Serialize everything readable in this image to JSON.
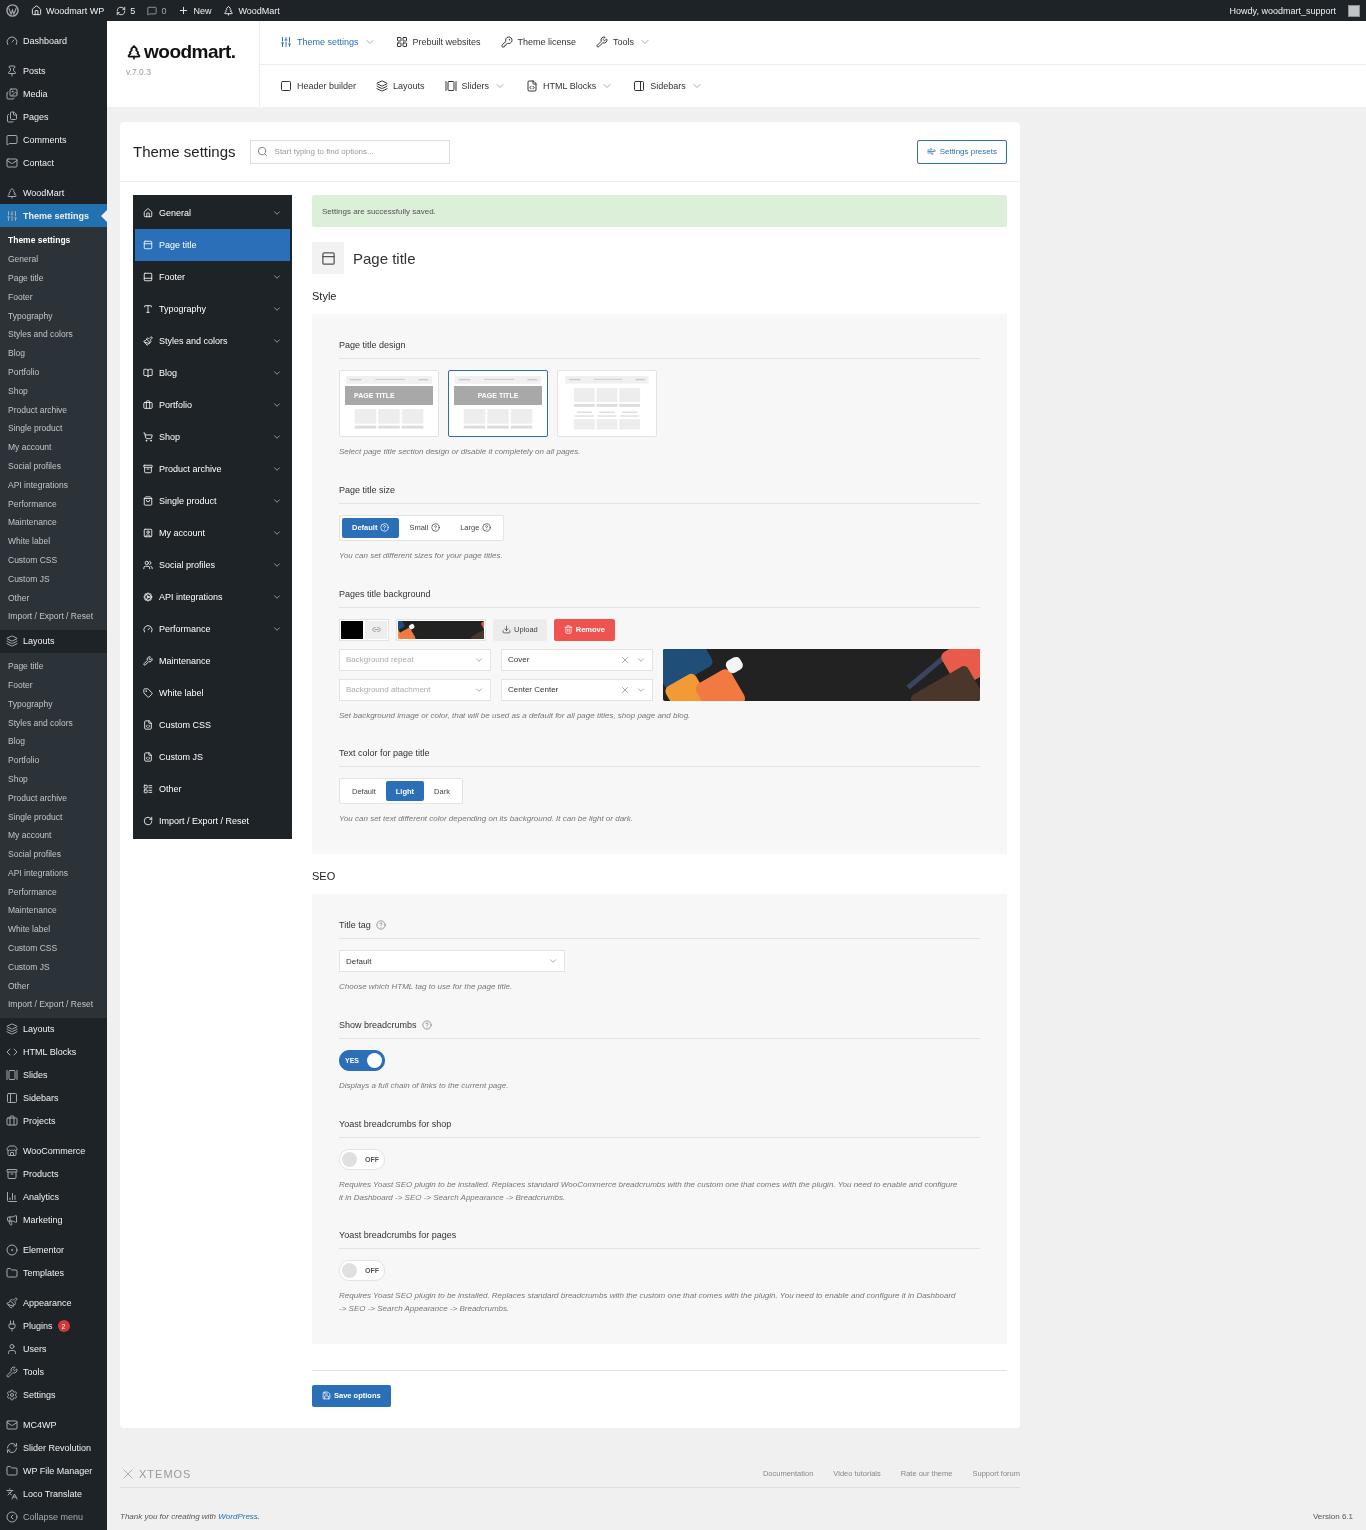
{
  "top_bar": {
    "site": "Woodmart WP",
    "updates": "5",
    "comments": "0",
    "new": "New",
    "brand": "WoodMart",
    "greeting": "Howdy, woodmart_support"
  },
  "admin_menu": [
    {
      "items": [
        {
          "label": "Dashboard",
          "selected": false
        }
      ]
    },
    {
      "items": [
        {
          "label": "Posts",
          "selected": false
        },
        {
          "label": "Media",
          "selected": false
        },
        {
          "label": "Pages",
          "selected": false
        },
        {
          "label": "Comments",
          "selected": false
        },
        {
          "label": "Contact",
          "selected": false
        }
      ]
    },
    {
      "items": [
        {
          "label": "WoodMart",
          "selected": false
        },
        {
          "label": "Theme settings",
          "selected": true,
          "submenu": [
            {
              "label": "Theme settings",
              "selected": true
            },
            {
              "label": "General",
              "selected": false
            },
            {
              "label": "Page title",
              "selected": false
            },
            {
              "label": "Footer",
              "selected": false
            },
            {
              "label": "Typography",
              "selected": false
            },
            {
              "label": "Styles and colors",
              "selected": false
            },
            {
              "label": "Blog",
              "selected": false
            },
            {
              "label": "Portfolio",
              "selected": false
            },
            {
              "label": "Shop",
              "selected": false
            },
            {
              "label": "Product archive",
              "selected": false
            },
            {
              "label": "Single product",
              "selected": false
            },
            {
              "label": "My account",
              "selected": false
            },
            {
              "label": "Social profiles",
              "selected": false
            },
            {
              "label": "API integrations",
              "selected": false
            },
            {
              "label": "Performance",
              "selected": false
            },
            {
              "label": "Maintenance",
              "selected": false
            },
            {
              "label": "White label",
              "selected": false
            },
            {
              "label": "Custom CSS",
              "selected": false
            },
            {
              "label": "Custom JS",
              "selected": false
            },
            {
              "label": "Other",
              "selected": false
            },
            {
              "label": "Import / Export / Reset",
              "selected": false
            }
          ]
        },
        {
          "label": "Layouts",
          "selected": false,
          "submenu": [
            {
              "label": "Page title",
              "selected": false
            },
            {
              "label": "Footer",
              "selected": false
            },
            {
              "label": "Typography",
              "selected": false
            },
            {
              "label": "Styles and colors",
              "selected": false
            },
            {
              "label": "Blog",
              "selected": false
            },
            {
              "label": "Portfolio",
              "selected": false
            },
            {
              "label": "Shop",
              "selected": false
            },
            {
              "label": "Product archive",
              "selected": false
            },
            {
              "label": "Single product",
              "selected": false
            },
            {
              "label": "My account",
              "selected": false
            },
            {
              "label": "Social profiles",
              "selected": false
            },
            {
              "label": "API integrations",
              "selected": false
            },
            {
              "label": "Performance",
              "selected": false
            },
            {
              "label": "Maintenance",
              "selected": false
            },
            {
              "label": "White label",
              "selected": false
            },
            {
              "label": "Custom CSS",
              "selected": false
            },
            {
              "label": "Custom JS",
              "selected": false
            },
            {
              "label": "Other",
              "selected": false
            },
            {
              "label": "Import / Export / Reset",
              "selected": false
            }
          ]
        },
        {
          "label": "Layouts",
          "selected": false
        },
        {
          "label": "HTML Blocks",
          "selected": false
        },
        {
          "label": "Slides",
          "selected": false
        },
        {
          "label": "Sidebars",
          "selected": false
        },
        {
          "label": "Projects",
          "selected": false
        }
      ]
    },
    {
      "items": [
        {
          "label": "WooCommerce",
          "selected": false
        },
        {
          "label": "Products",
          "selected": false
        },
        {
          "label": "Analytics",
          "selected": false
        },
        {
          "label": "Marketing",
          "selected": false
        }
      ]
    },
    {
      "items": [
        {
          "label": "Elementor",
          "selected": false
        },
        {
          "label": "Templates",
          "selected": false
        }
      ]
    },
    {
      "items": [
        {
          "label": "Appearance",
          "selected": false
        },
        {
          "label": "Plugins",
          "selected": false,
          "badge": "2"
        },
        {
          "label": "Users",
          "selected": false
        },
        {
          "label": "Tools",
          "selected": false
        },
        {
          "label": "Settings",
          "selected": false
        }
      ]
    },
    {
      "items": [
        {
          "label": "MC4WP",
          "selected": false
        },
        {
          "label": "Slider Revolution",
          "selected": false
        },
        {
          "label": "WP File Manager",
          "selected": false
        },
        {
          "label": "Loco Translate",
          "selected": false
        },
        {
          "label": "Collapse menu",
          "selected": false,
          "muted": true
        }
      ]
    }
  ],
  "header": {
    "logo": "woodmart.",
    "version": "v.7.0.3",
    "nav_rows": [
      [
        {
          "label": "Theme settings",
          "selected": true,
          "dropdown": true
        },
        {
          "label": "Prebuilt websites",
          "selected": false,
          "dropdown": false
        },
        {
          "label": "Theme license",
          "selected": false,
          "dropdown": false
        },
        {
          "label": "Tools",
          "selected": false,
          "dropdown": true
        }
      ],
      [
        {
          "label": "Header builder",
          "selected": false,
          "dropdown": false
        },
        {
          "label": "Layouts",
          "selected": false,
          "dropdown": false
        },
        {
          "label": "Sliders",
          "selected": false,
          "dropdown": true
        },
        {
          "label": "HTML Blocks",
          "selected": false,
          "dropdown": true
        },
        {
          "label": "Sidebars",
          "selected": false,
          "dropdown": true
        }
      ]
    ]
  },
  "panel": {
    "title": "Theme settings",
    "search": {
      "placeholder": "Start typing to find options..."
    },
    "presets_button": "Settings presets"
  },
  "nav": [
    {
      "label": "General",
      "selected": false,
      "expandable": true
    },
    {
      "label": "Page title",
      "selected": true,
      "expandable": false
    },
    {
      "label": "Footer",
      "selected": false,
      "expandable": true
    },
    {
      "label": "Typography",
      "selected": false,
      "expandable": true
    },
    {
      "label": "Styles and colors",
      "selected": false,
      "expandable": true
    },
    {
      "label": "Blog",
      "selected": false,
      "expandable": true
    },
    {
      "label": "Portfolio",
      "selected": false,
      "expandable": true
    },
    {
      "label": "Shop",
      "selected": false,
      "expandable": true
    },
    {
      "label": "Product archive",
      "selected": false,
      "expandable": true
    },
    {
      "label": "Single product",
      "selected": false,
      "expandable": true
    },
    {
      "label": "My account",
      "selected": false,
      "expandable": true
    },
    {
      "label": "Social profiles",
      "selected": false,
      "expandable": true
    },
    {
      "label": "API integrations",
      "selected": false,
      "expandable": true
    },
    {
      "label": "Performance",
      "selected": false,
      "expandable": true
    },
    {
      "label": "Maintenance",
      "selected": false,
      "expandable": false
    },
    {
      "label": "White label",
      "selected": false,
      "expandable": false
    },
    {
      "label": "Custom CSS",
      "selected": false,
      "expandable": false
    },
    {
      "label": "Custom JS",
      "selected": false,
      "expandable": false
    },
    {
      "label": "Other",
      "selected": false,
      "expandable": false
    },
    {
      "label": "Import / Export / Reset",
      "selected": false,
      "expandable": false
    }
  ],
  "notice": "Settings are successfully saved.",
  "page_heading": "Page title",
  "sections": [
    {
      "title": "Style",
      "fields": [
        {
          "kind": "designs",
          "title": "Page title design",
          "options": [
            {
              "kind": "left",
              "label": "PAGE TITLE",
              "selected": false
            },
            {
              "kind": "center",
              "label": "PAGE TITLE",
              "selected": true
            },
            {
              "kind": "none",
              "selected": false
            }
          ],
          "hint": "Select page title section design or disable it completely on all pages."
        },
        {
          "kind": "choice",
          "title": "Page title size",
          "options": [
            {
              "label": "Default",
              "selected": true,
              "help": true
            },
            {
              "label": "Small",
              "selected": false,
              "help": true
            },
            {
              "label": "Large",
              "selected": false,
              "help": true
            }
          ],
          "hint": "You can set different sizes for your page titles."
        },
        {
          "kind": "background",
          "title": "Pages title background",
          "color": "#000000",
          "upload": "Upload",
          "remove": "Remove",
          "selects": [
            {
              "placeholder": "Background repeat"
            },
            {
              "value": "Cover"
            },
            {
              "placeholder": "Background attachment"
            },
            {
              "value": "Center Center"
            }
          ],
          "hint": "Set background image or color, that will be used as a default for all page titles, shop page and blog."
        },
        {
          "kind": "choice",
          "title": "Text color for page title",
          "options": [
            {
              "label": "Default",
              "selected": false,
              "help": false
            },
            {
              "label": "Light",
              "selected": true,
              "help": false
            },
            {
              "label": "Dark",
              "selected": false,
              "help": false
            }
          ],
          "hint": "You can set text different color depending on its background. It can be light or dark."
        }
      ]
    },
    {
      "title": "SEO",
      "fields": [
        {
          "kind": "select",
          "title": "Title tag",
          "help": true,
          "value": "Default",
          "hint": "Choose which HTML tag to use for the page title."
        },
        {
          "kind": "switch",
          "title": "Show breadcrumbs",
          "help": true,
          "on": true,
          "label": "YES",
          "hint": "Displays a full chain of links to the current page."
        },
        {
          "kind": "switch",
          "title": "Yoast breadcrumbs for shop",
          "help": false,
          "on": false,
          "label": "OFF",
          "hint": "Requires Yoast SEO plugin to be installed. Replaces standard WooCommerce breadcrumbs with the custom one that comes with the plugin. You need to enable and configure it in Dashboard -> SEO -> Search Appearance -> Breadcrumbs."
        },
        {
          "kind": "switch",
          "title": "Yoast breadcrumbs for pages",
          "help": false,
          "on": false,
          "label": "OFF",
          "hint": "Requires Yoast SEO plugin to be installed. Replaces standard breadcrumbs with the custom one that comes with the plugin. You need to enable and configure it in Dashboard -> SEO -> Search Appearance -> Breadcrumbs."
        }
      ]
    }
  ],
  "save_button": "Save options",
  "footer": {
    "logo": "XTEMOS",
    "links": [
      "Documentation",
      "Video tutorials",
      "Rate our theme",
      "Support forum"
    ],
    "thanks": "Thank you for creating with ",
    "thanks_link": "WordPress",
    "thanks_end": ".",
    "version": "Version 6.1"
  }
}
